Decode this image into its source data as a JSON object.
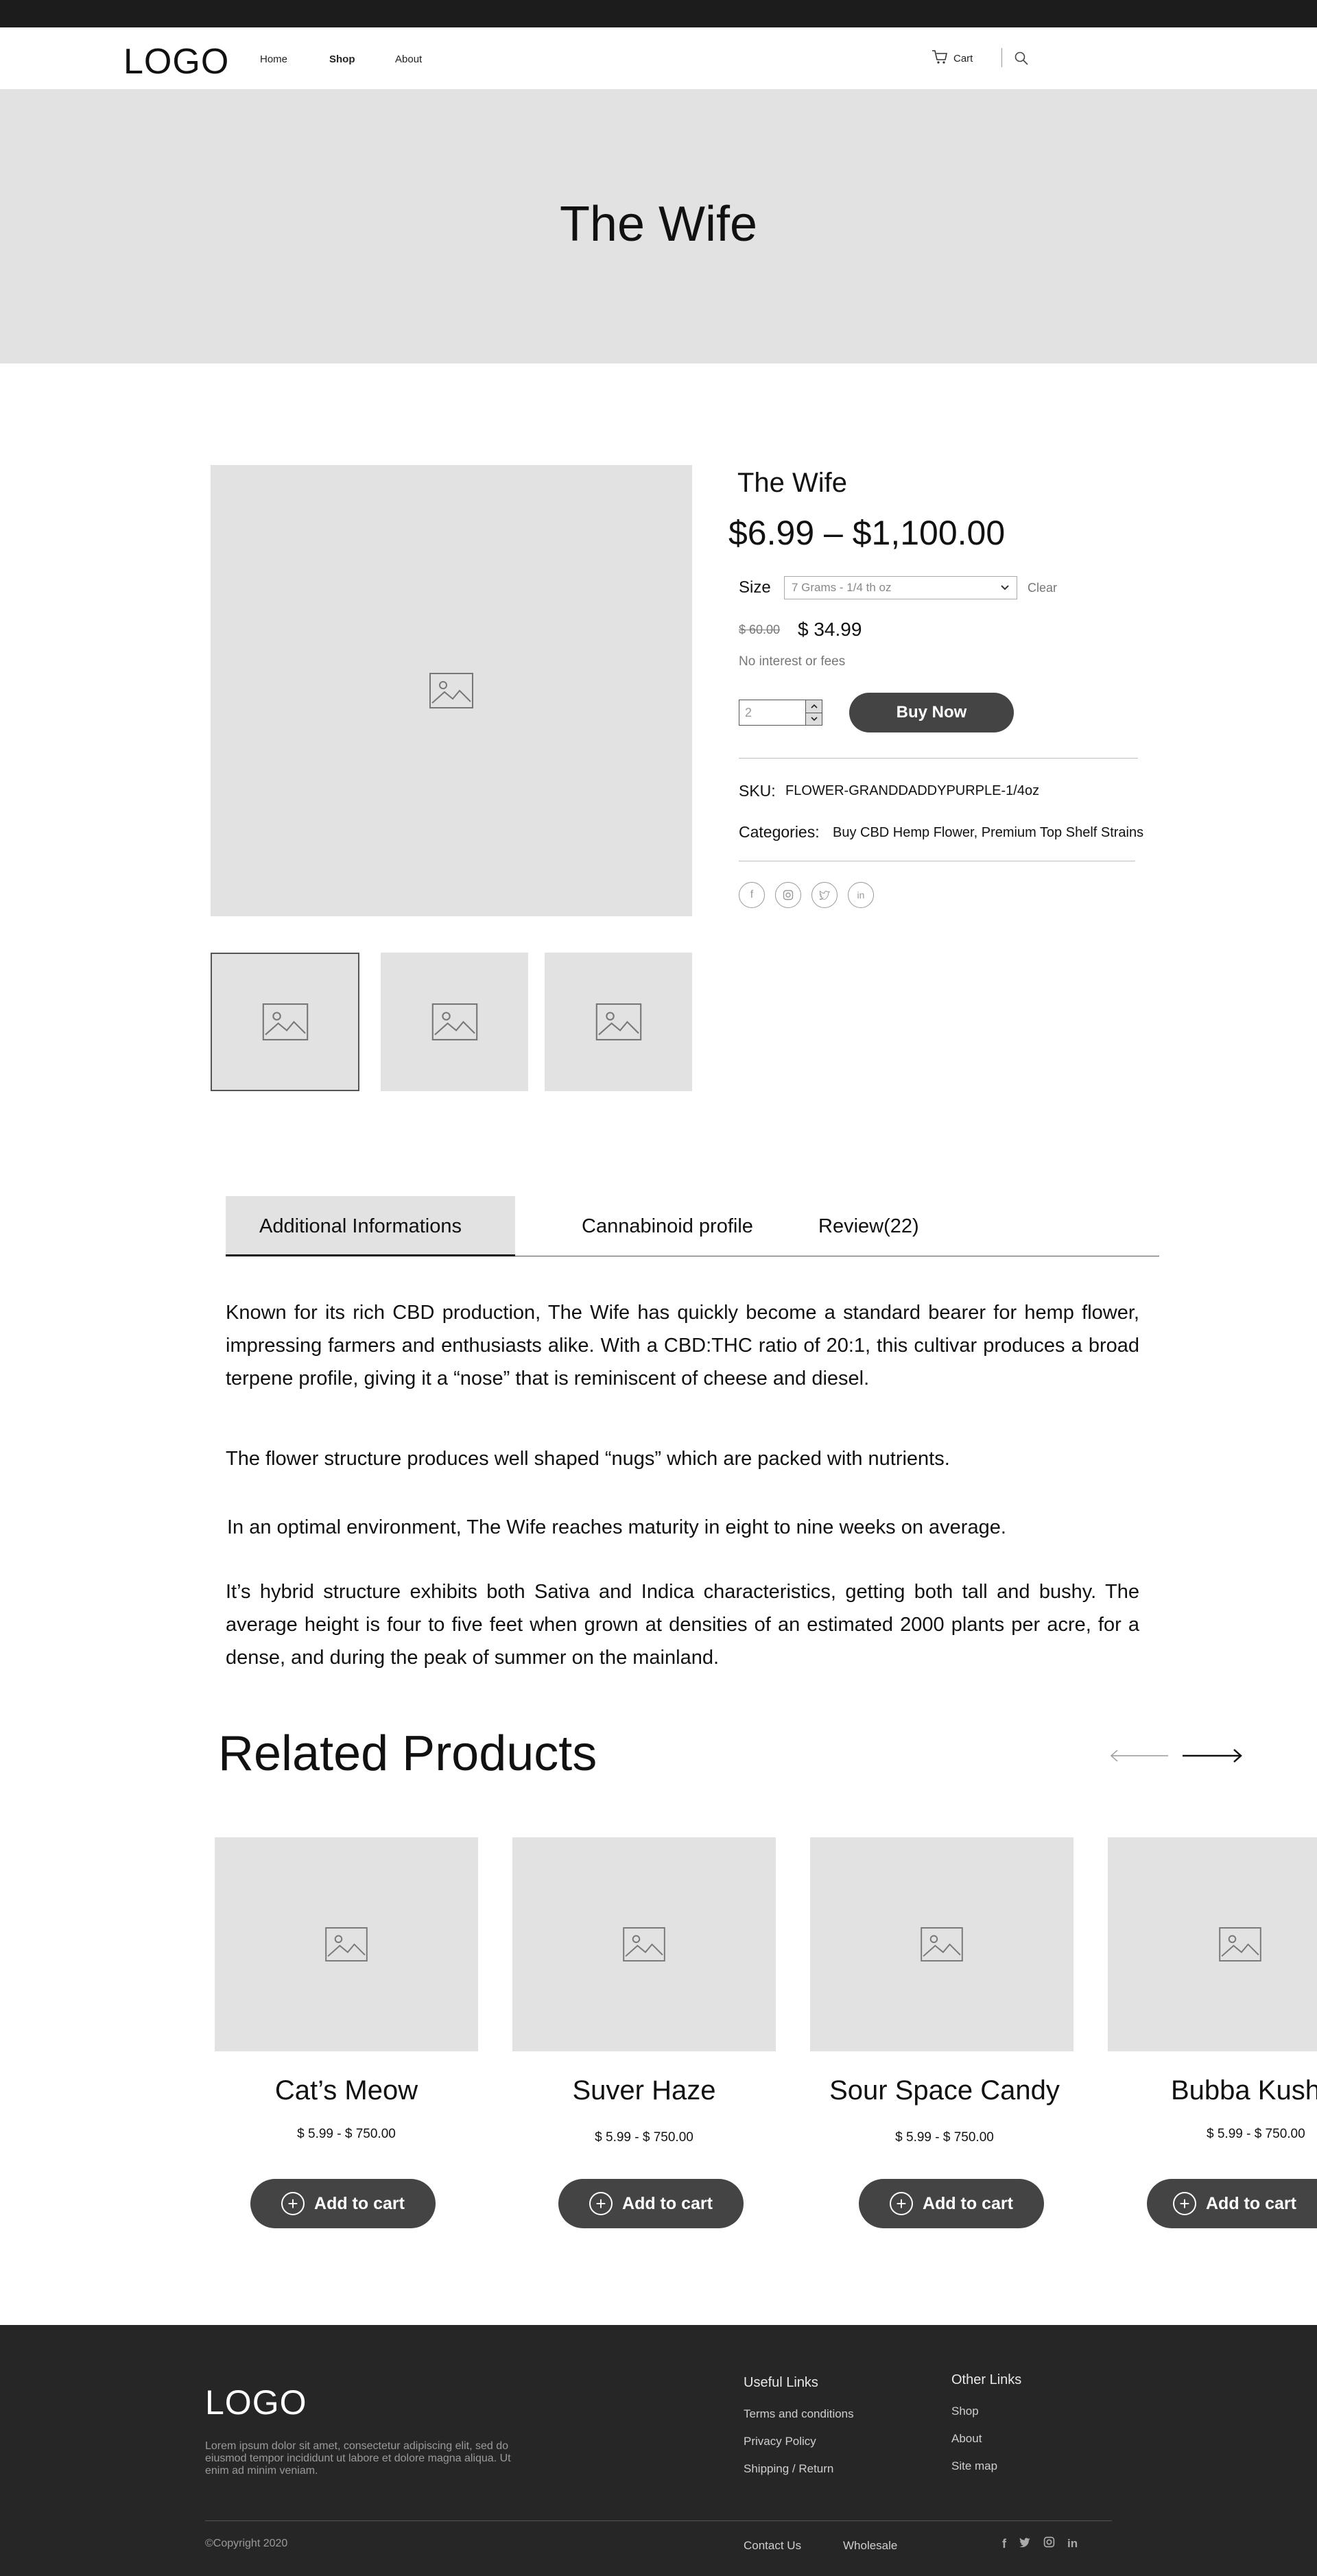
{
  "header": {
    "logo": "LOGO",
    "nav": [
      "Home",
      "Shop",
      "About"
    ],
    "cart_label": "Cart"
  },
  "hero": {
    "title": "The Wife"
  },
  "product": {
    "name": "The Wife",
    "price_range": "$6.99 – $1,100.00",
    "size_label": "Size",
    "size_selected": "7 Grams - 1/4 th oz",
    "clear_label": "Clear",
    "old_price": "$ 60.00",
    "new_price": "$ 34.99",
    "interest_note": "No interest or fees",
    "quantity": "2",
    "buy_label": "Buy Now",
    "sku_label": "SKU:",
    "sku_value": "FLOWER-GRANDDADDYPURPLE-1/4oz",
    "categories_label": "Categories:",
    "categories_value": "Buy CBD Hemp Flower, Premium Top Shelf Strains",
    "social_icons": [
      "facebook-icon",
      "instagram-icon",
      "twitter-icon",
      "linkedin-icon"
    ]
  },
  "tabs": {
    "items": [
      "Additional Informations",
      "Cannabinoid profile",
      "Review(22)"
    ],
    "active_index": 0
  },
  "description": {
    "paragraphs": [
      "Known for its rich CBD production, The Wife has quickly become a standard bearer for hemp flower, impressing farmers and enthusiasts alike. With a CBD:THC ratio of 20:1, this cultivar produces a broad terpene profile, giving it a “nose” that is reminiscent of cheese and diesel.",
      "The flower structure produces well shaped “nugs” which are packed with nutrients.",
      "In an optimal environment, The Wife reaches maturity in eight to nine weeks on average.",
      "It’s hybrid structure exhibits both Sativa and Indica characteristics, getting both tall and bushy. The average height is four to five feet when grown at densities of an estimated 2000 plants per acre, for a dense, and during the peak of summer on the mainland."
    ]
  },
  "related": {
    "title": "Related Products",
    "add_label": "Add to cart",
    "items": [
      {
        "name": "Cat’s Meow",
        "price": "$ 5.99 - $ 750.00"
      },
      {
        "name": "Suver Haze",
        "price": "$ 5.99 - $ 750.00"
      },
      {
        "name": "Sour Space Candy",
        "price": "$ 5.99 - $ 750.00"
      },
      {
        "name": "Bubba Kush",
        "price": "$ 5.99 - $ 750.00"
      }
    ]
  },
  "footer": {
    "logo": "LOGO",
    "about": "Lorem ipsum dolor sit amet, consectetur adipiscing elit, sed do eiusmod tempor incididunt ut labore et dolore magna aliqua. Ut enim ad minim veniam.",
    "useful_title": "Useful Links",
    "useful_links": [
      "Terms and conditions",
      "Privacy Policy",
      "Shipping / Return"
    ],
    "other_title": "Other Links",
    "other_links": [
      "Shop",
      "About",
      "Site map"
    ],
    "copyright": "©Copyright 2020",
    "bottom_links": [
      "Contact Us",
      "Wholesale"
    ],
    "social_icons": [
      "facebook-icon",
      "twitter-icon",
      "instagram-icon",
      "linkedin-icon"
    ]
  },
  "colors": {
    "dark": "#1c1c1c",
    "placeholder": "#e2e2e2",
    "button": "#444444",
    "footer": "#262626"
  }
}
